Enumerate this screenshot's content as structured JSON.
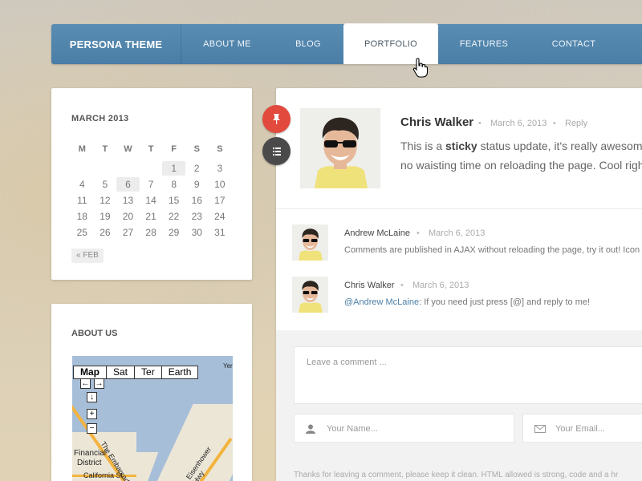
{
  "nav": {
    "brand": "PERSONA THEME",
    "items": [
      {
        "label": "ABOUT ME"
      },
      {
        "label": "BLOG"
      },
      {
        "label": "PORTFOLIO",
        "active": true
      },
      {
        "label": "FEATURES"
      },
      {
        "label": "CONTACT"
      }
    ]
  },
  "calendar": {
    "title": "MARCH 2013",
    "weekdays": [
      "M",
      "T",
      "W",
      "T",
      "F",
      "S",
      "S"
    ],
    "weeks": [
      [
        "",
        "",
        "",
        "",
        "1",
        "2",
        "3"
      ],
      [
        "4",
        "5",
        "6",
        "7",
        "8",
        "9",
        "10"
      ],
      [
        "11",
        "12",
        "13",
        "14",
        "15",
        "16",
        "17"
      ],
      [
        "18",
        "19",
        "20",
        "21",
        "22",
        "23",
        "24"
      ],
      [
        "25",
        "26",
        "27",
        "28",
        "29",
        "30",
        "31"
      ]
    ],
    "highlighted": [
      "1",
      "6"
    ],
    "prev_link": "« FEB"
  },
  "about": {
    "title": "ABOUT US",
    "map": {
      "tabs": [
        "Map",
        "Sat",
        "Ter",
        "Earth"
      ],
      "selected_tab": "Map",
      "labels": {
        "financial": "Financial",
        "district": "District",
        "california": "California St",
        "embarcadero": "The Embarcadero",
        "eisenhower": "Eisenhower Hwy",
        "yer": "Yer"
      }
    }
  },
  "post": {
    "author": "Chris Walker",
    "date": "March 6, 2013",
    "reply": "Reply",
    "text_pre": "This is a ",
    "text_bold": "sticky",
    "text_post": " status update, it's really awesome",
    "text_line2": "no waisting time on reloading the page. Cool right"
  },
  "comments": [
    {
      "author": "Andrew McLaine",
      "date": "March 6, 2013",
      "text": "Comments are published in AJAX without reloading the page, try it out! Icon"
    },
    {
      "author": "Chris Walker",
      "date": "March 6, 2013",
      "mention": "@Andrew McLaine",
      "text": ": If you need just press [@] and reply to me!"
    }
  ],
  "form": {
    "comment_placeholder": "Leave a comment ...",
    "name_placeholder": "Your Name...",
    "email_placeholder": "Your Email...",
    "note": "Thanks for leaving a comment, please keep it clean. HTML allowed is strong, code and a hr"
  },
  "colors": {
    "nav": "#4a7ea6",
    "pin": "#e14a3c",
    "mention": "#4a7ea6"
  }
}
